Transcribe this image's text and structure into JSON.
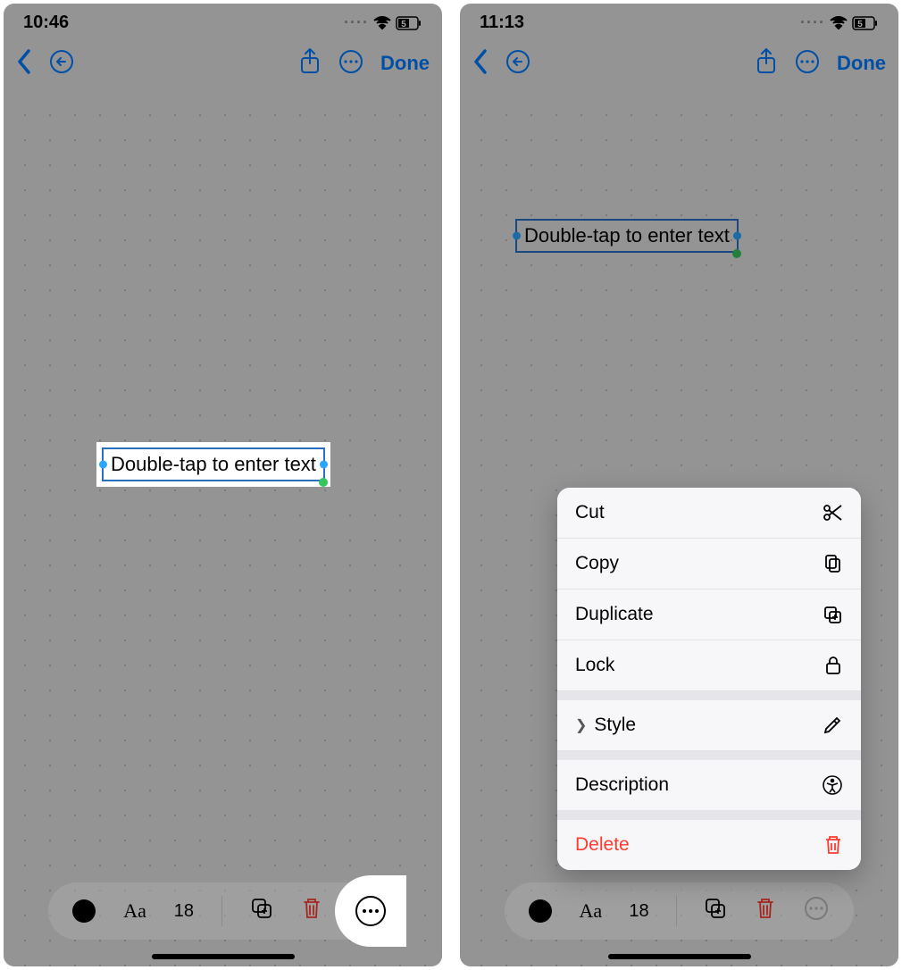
{
  "screens": [
    {
      "status": {
        "time": "10:46",
        "battery_label": "5"
      },
      "nav": {
        "done_label": "Done"
      },
      "textbox": {
        "placeholder": "Double-tap to enter text"
      },
      "toolbar": {
        "font_label": "Aa",
        "font_size": "18"
      }
    },
    {
      "status": {
        "time": "11:13",
        "battery_label": "5"
      },
      "nav": {
        "done_label": "Done"
      },
      "textbox": {
        "placeholder": "Double-tap to enter text"
      },
      "toolbar": {
        "font_label": "Aa",
        "font_size": "18"
      },
      "context_menu": {
        "cut": "Cut",
        "copy": "Copy",
        "duplicate": "Duplicate",
        "lock": "Lock",
        "style": "Style",
        "description": "Description",
        "delete": "Delete"
      }
    }
  ]
}
